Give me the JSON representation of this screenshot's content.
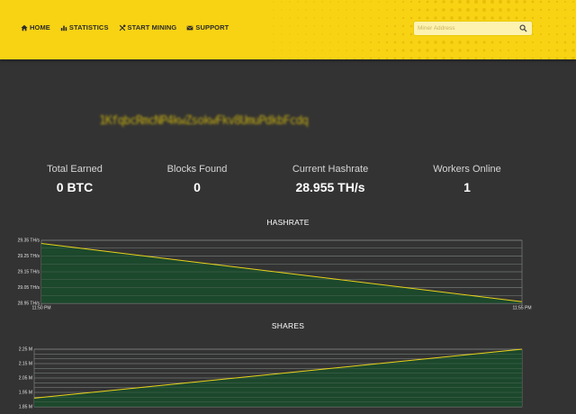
{
  "nav": {
    "items": [
      {
        "label": "HOME",
        "icon": "home-icon"
      },
      {
        "label": "STATISTICS",
        "icon": "bar-chart-icon"
      },
      {
        "label": "START MINING",
        "icon": "tools-icon"
      },
      {
        "label": "SUPPORT",
        "icon": "envelope-icon"
      }
    ]
  },
  "search": {
    "placeholder": "Miner Address",
    "icon": "search-icon"
  },
  "miner_address": "1KfqbcRmcNP4kwZsokwFkv8UmuPdkbFcdq",
  "stats": [
    {
      "label": "Total Earned",
      "value": "0 BTC"
    },
    {
      "label": "Blocks Found",
      "value": "0"
    },
    {
      "label": "Current Hashrate",
      "value": "28.955 TH/s"
    },
    {
      "label": "Workers Online",
      "value": "1"
    }
  ],
  "colors": {
    "header": "#f8d314",
    "background": "#333333",
    "line": "#e8d21a",
    "area": "#1b4a2c"
  },
  "chart_data": [
    {
      "type": "area",
      "title": "HASHRATE",
      "x": [
        "11:50 PM",
        "11:55 PM"
      ],
      "values": [
        29.33,
        28.96
      ],
      "unit": "TH/s",
      "yticks": [
        "29.35 TH/s",
        "29.25 TH/s",
        "29.15 TH/s",
        "29.05 TH/s",
        "28.95 TH/s"
      ],
      "xticks": [
        "11:50 PM",
        "11:55 PM"
      ],
      "ylim": [
        28.95,
        29.35
      ],
      "grid": true
    },
    {
      "type": "area",
      "title": "SHARES",
      "x": [
        "11:50 PM",
        "11:55 PM"
      ],
      "values": [
        1.91,
        2.25
      ],
      "unit": "M",
      "yticks": [
        "2.25 M",
        "2.15 M",
        "2.05 M",
        "1.95 M",
        "1.85 M"
      ],
      "ylim": [
        1.85,
        2.25
      ],
      "grid": true
    }
  ]
}
